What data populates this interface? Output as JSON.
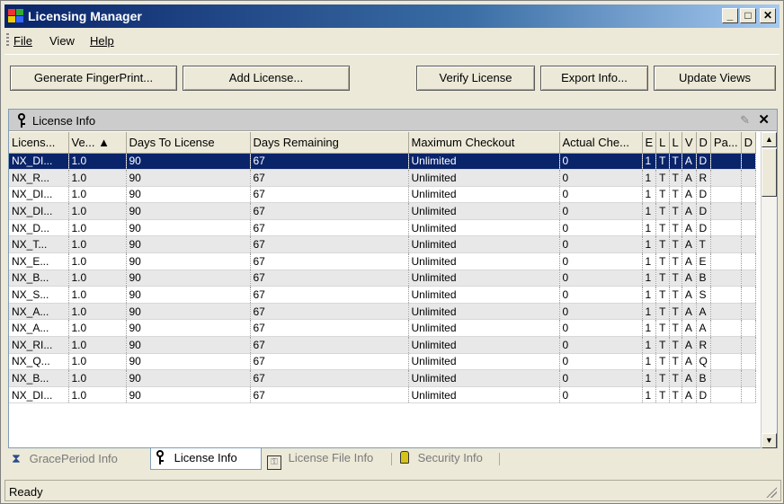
{
  "window": {
    "title": "Licensing Manager",
    "min": "_",
    "max": "□",
    "close": "✕"
  },
  "menu": {
    "file": "File",
    "view": "View",
    "help": "Help"
  },
  "toolbar": {
    "generate": "Generate FingerPrint...",
    "add": "Add License...",
    "verify": "Verify License",
    "export": "Export Info...",
    "update": "Update Views"
  },
  "panel": {
    "title": "License Info",
    "pin": "✎",
    "close": "✕"
  },
  "columns": [
    "Licens...",
    "Ve... ▲",
    "Days To License",
    "Days Remaining",
    "Maximum Checkout",
    "Actual Che...",
    "E",
    "L",
    "L",
    "V",
    "D",
    "Pa...",
    "D"
  ],
  "rows": [
    [
      "NX_DI...",
      "1.0",
      "90",
      "67",
      "Unlimited",
      "0",
      "1",
      "T",
      "T",
      "A",
      "D",
      "",
      ""
    ],
    [
      "NX_R...",
      "1.0",
      "90",
      "67",
      "Unlimited",
      "0",
      "1",
      "T",
      "T",
      "A",
      "R",
      "",
      ""
    ],
    [
      "NX_DI...",
      "1.0",
      "90",
      "67",
      "Unlimited",
      "0",
      "1",
      "T",
      "T",
      "A",
      "D",
      "",
      ""
    ],
    [
      "NX_DI...",
      "1.0",
      "90",
      "67",
      "Unlimited",
      "0",
      "1",
      "T",
      "T",
      "A",
      "D",
      "",
      ""
    ],
    [
      "NX_D...",
      "1.0",
      "90",
      "67",
      "Unlimited",
      "0",
      "1",
      "T",
      "T",
      "A",
      "D",
      "",
      ""
    ],
    [
      "NX_T...",
      "1.0",
      "90",
      "67",
      "Unlimited",
      "0",
      "1",
      "T",
      "T",
      "A",
      "T",
      "",
      ""
    ],
    [
      "NX_E...",
      "1.0",
      "90",
      "67",
      "Unlimited",
      "0",
      "1",
      "T",
      "T",
      "A",
      "E",
      "",
      ""
    ],
    [
      "NX_B...",
      "1.0",
      "90",
      "67",
      "Unlimited",
      "0",
      "1",
      "T",
      "T",
      "A",
      "B",
      "",
      ""
    ],
    [
      "NX_S...",
      "1.0",
      "90",
      "67",
      "Unlimited",
      "0",
      "1",
      "T",
      "T",
      "A",
      "S",
      "",
      ""
    ],
    [
      "NX_A...",
      "1.0",
      "90",
      "67",
      "Unlimited",
      "0",
      "1",
      "T",
      "T",
      "A",
      "A",
      "",
      ""
    ],
    [
      "NX_A...",
      "1.0",
      "90",
      "67",
      "Unlimited",
      "0",
      "1",
      "T",
      "T",
      "A",
      "A",
      "",
      ""
    ],
    [
      "NX_RI...",
      "1.0",
      "90",
      "67",
      "Unlimited",
      "0",
      "1",
      "T",
      "T",
      "A",
      "R",
      "",
      ""
    ],
    [
      "NX_Q...",
      "1.0",
      "90",
      "67",
      "Unlimited",
      "0",
      "1",
      "T",
      "T",
      "A",
      "Q",
      "",
      ""
    ],
    [
      "NX_B...",
      "1.0",
      "90",
      "67",
      "Unlimited",
      "0",
      "1",
      "T",
      "T",
      "A",
      "B",
      "",
      ""
    ],
    [
      "NX_DI...",
      "1.0",
      "90",
      "67",
      "Unlimited",
      "0",
      "1",
      "T",
      "T",
      "A",
      "D",
      "",
      ""
    ]
  ],
  "tabs": [
    {
      "label": "GracePeriod Info",
      "icon": "hourglass-icon"
    },
    {
      "label": "License Info",
      "icon": "key-icon"
    },
    {
      "label": "License File Info",
      "icon": "license-file-icon"
    },
    {
      "label": "Security Info",
      "icon": "lock-icon"
    }
  ],
  "status": "Ready",
  "colors": {
    "selection": "#0a246a",
    "title_bar": "#0a246a",
    "alt_row": "#e8e8e8"
  }
}
